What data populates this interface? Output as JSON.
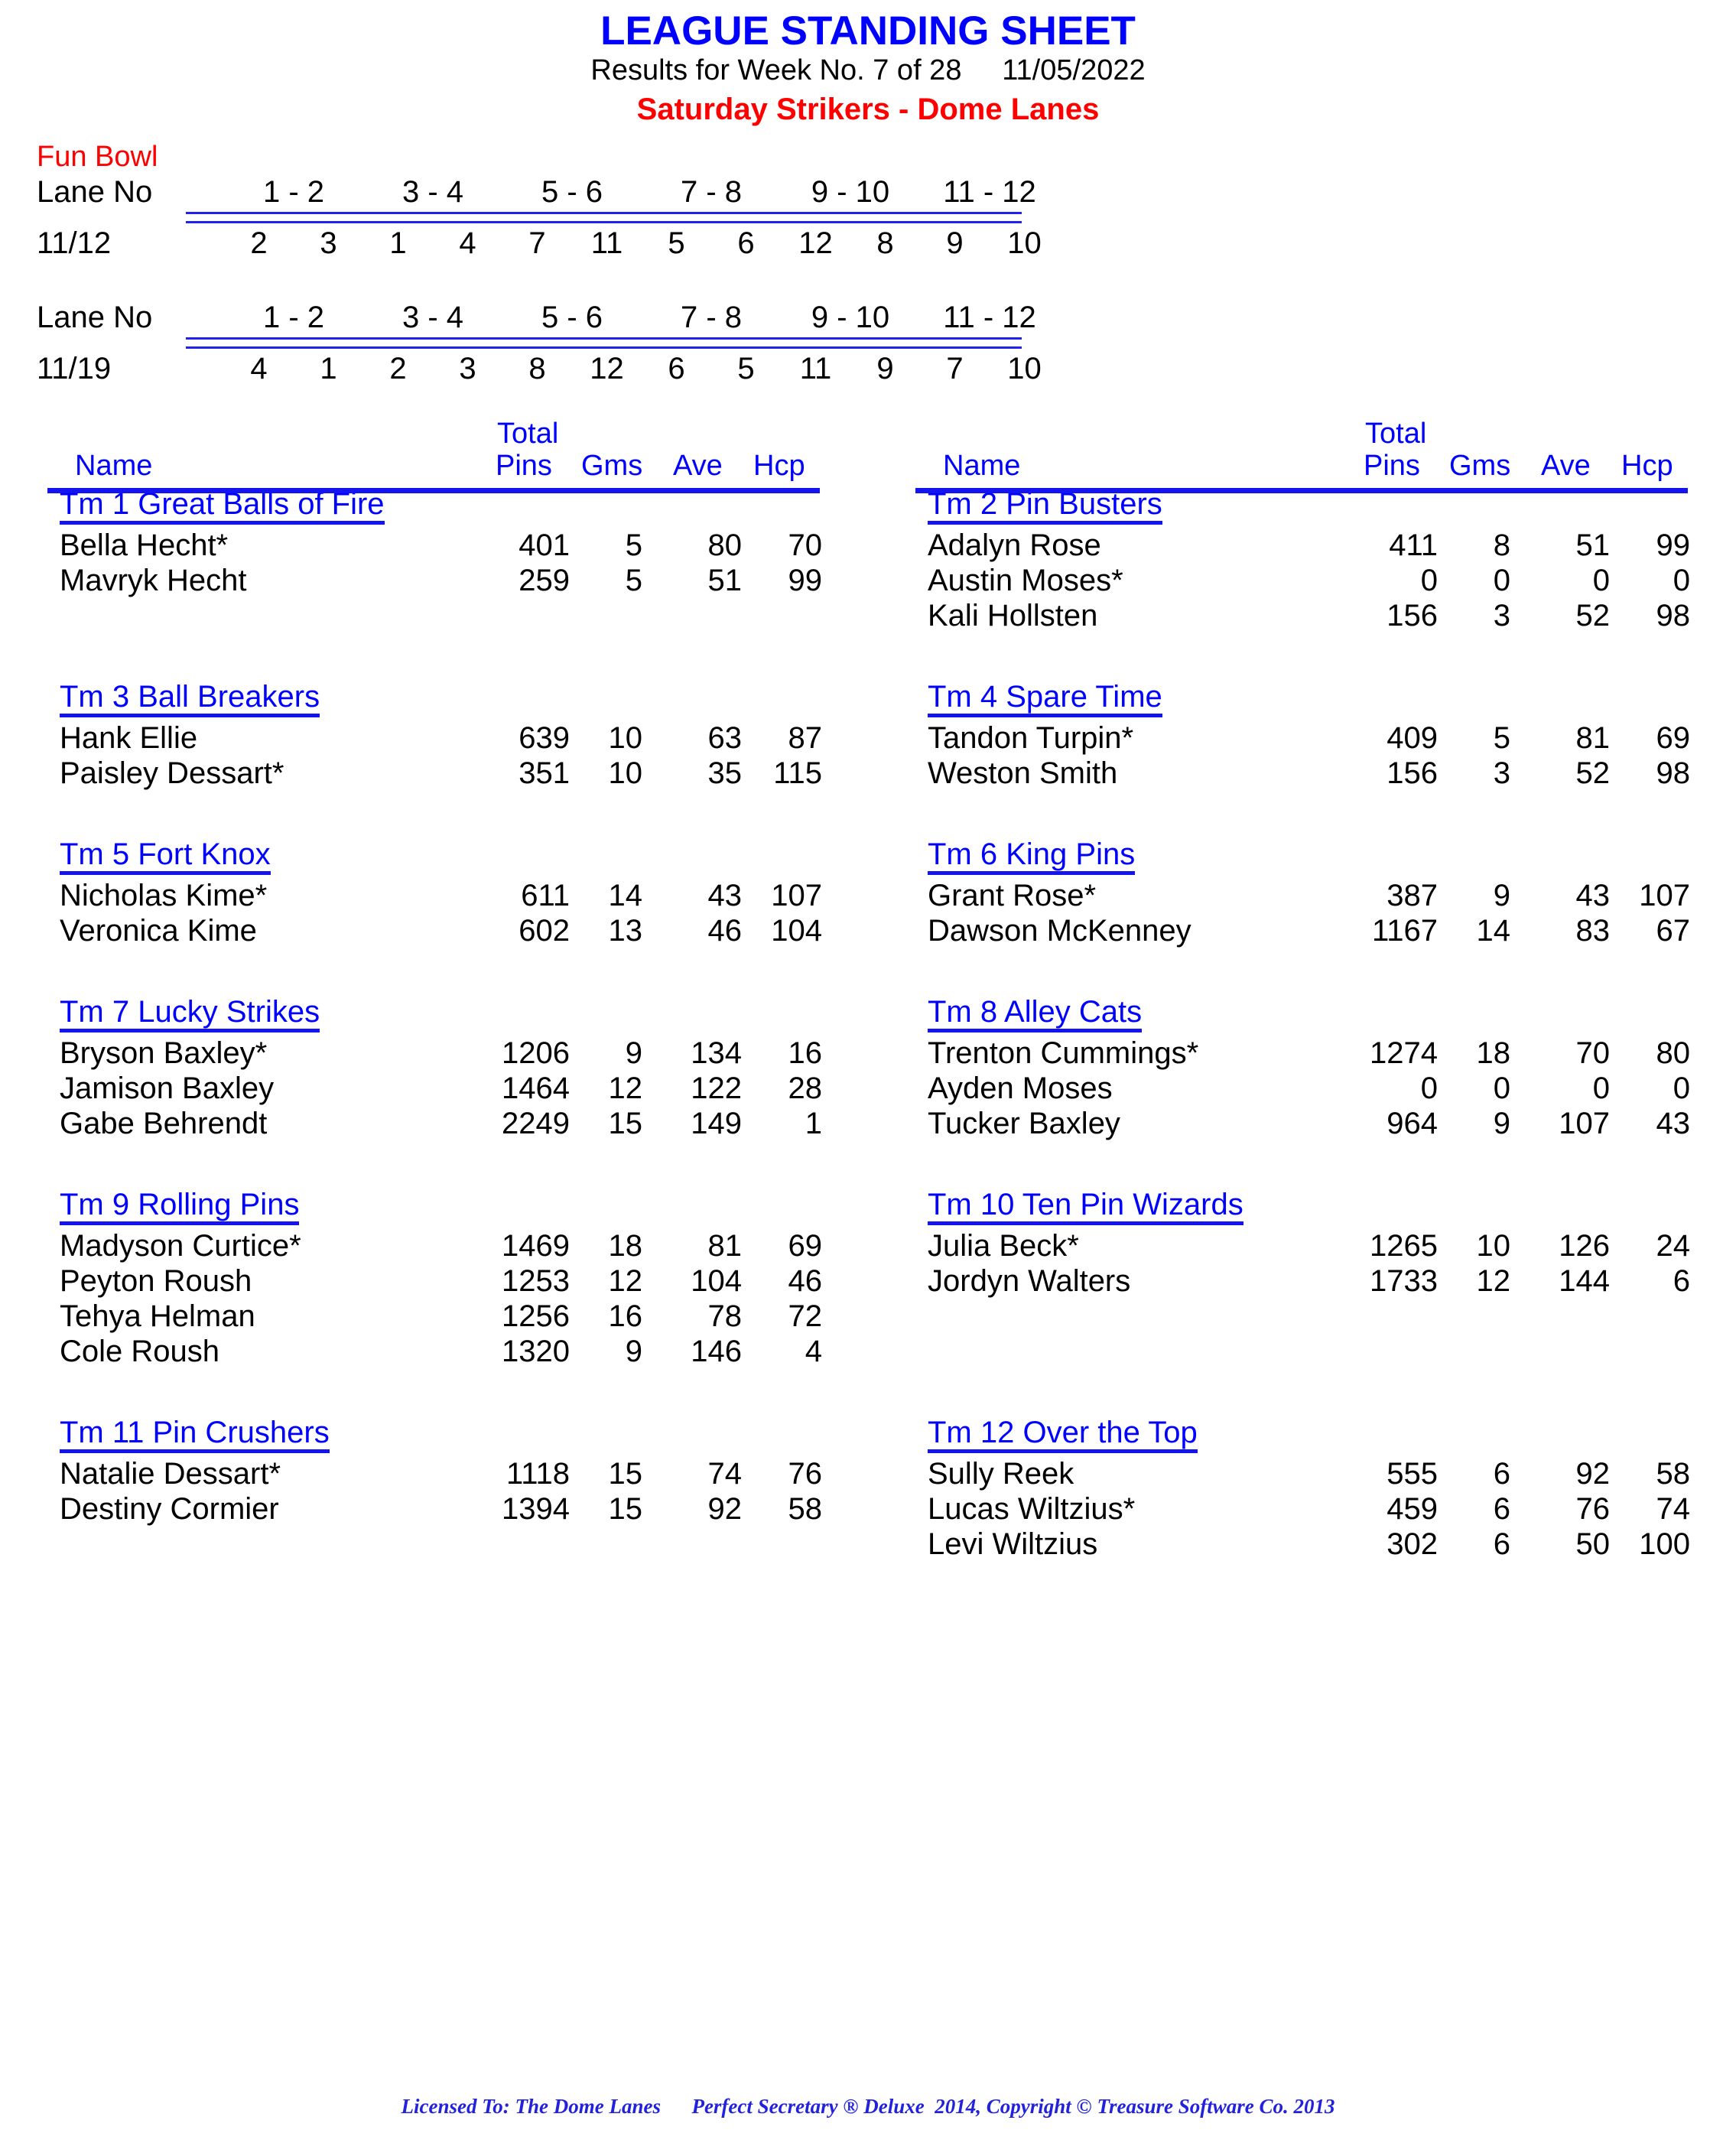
{
  "header": {
    "title": "LEAGUE STANDING SHEET",
    "results_line": "Results for Week No. 7 of 28     11/05/2022",
    "league_line": "Saturday Strikers - Dome Lanes",
    "title_color": "#0000FF",
    "league_color": "#FF0000"
  },
  "center": {
    "name": "Fun Bowl",
    "name_color": "#FF0000"
  },
  "schedule": {
    "lane_label": "Lane No",
    "lane_pairs": [
      "1 - 2",
      "3 - 4",
      "5 - 6",
      "7 - 8",
      "9 - 10",
      "11 - 12"
    ],
    "weeks": [
      {
        "date": "11/12",
        "teams": [
          "2",
          "3",
          "1",
          "4",
          "7",
          "11",
          "5",
          "6",
          "12",
          "8",
          "9",
          "10"
        ]
      },
      {
        "date": "11/19",
        "teams": [
          "4",
          "1",
          "2",
          "3",
          "8",
          "12",
          "6",
          "5",
          "11",
          "9",
          "7",
          "10"
        ]
      }
    ]
  },
  "table_headers": {
    "total": "Total",
    "name": "Name",
    "pins": "Pins",
    "gms": "Gms",
    "ave": "Ave",
    "hcp": "Hcp",
    "header_color": "#0000FF"
  },
  "left_column": [
    {
      "team": "Tm 1 Great Balls of Fire",
      "players": [
        {
          "name": "Bella Hecht*",
          "pins": "401",
          "gms": "5",
          "ave": "80",
          "hcp": "70"
        },
        {
          "name": "Mavryk Hecht",
          "pins": "259",
          "gms": "5",
          "ave": "51",
          "hcp": "99"
        }
      ]
    },
    {
      "team": "Tm 3 Ball Breakers",
      "players": [
        {
          "name": "Hank Ellie",
          "pins": "639",
          "gms": "10",
          "ave": "63",
          "hcp": "87"
        },
        {
          "name": "Paisley Dessart*",
          "pins": "351",
          "gms": "10",
          "ave": "35",
          "hcp": "115"
        }
      ]
    },
    {
      "team": "Tm 5 Fort Knox",
      "players": [
        {
          "name": "Nicholas Kime*",
          "pins": "611",
          "gms": "14",
          "ave": "43",
          "hcp": "107"
        },
        {
          "name": "Veronica Kime",
          "pins": "602",
          "gms": "13",
          "ave": "46",
          "hcp": "104"
        }
      ]
    },
    {
      "team": "Tm 7 Lucky Strikes",
      "players": [
        {
          "name": "Bryson Baxley*",
          "pins": "1206",
          "gms": "9",
          "ave": "134",
          "hcp": "16"
        },
        {
          "name": "Jamison Baxley",
          "pins": "1464",
          "gms": "12",
          "ave": "122",
          "hcp": "28"
        },
        {
          "name": "Gabe Behrendt",
          "pins": "2249",
          "gms": "15",
          "ave": "149",
          "hcp": "1"
        }
      ]
    },
    {
      "team": "Tm 9 Rolling Pins",
      "players": [
        {
          "name": "Madyson Curtice*",
          "pins": "1469",
          "gms": "18",
          "ave": "81",
          "hcp": "69"
        },
        {
          "name": "Peyton Roush",
          "pins": "1253",
          "gms": "12",
          "ave": "104",
          "hcp": "46"
        },
        {
          "name": "Tehya Helman",
          "pins": "1256",
          "gms": "16",
          "ave": "78",
          "hcp": "72"
        },
        {
          "name": "Cole Roush",
          "pins": "1320",
          "gms": "9",
          "ave": "146",
          "hcp": "4"
        }
      ]
    },
    {
      "team": "Tm 11 Pin Crushers",
      "players": [
        {
          "name": "Natalie Dessart*",
          "pins": "1118",
          "gms": "15",
          "ave": "74",
          "hcp": "76"
        },
        {
          "name": "Destiny Cormier",
          "pins": "1394",
          "gms": "15",
          "ave": "92",
          "hcp": "58"
        }
      ]
    }
  ],
  "right_column": [
    {
      "team": "Tm 2 Pin Busters",
      "players": [
        {
          "name": "Adalyn Rose",
          "pins": "411",
          "gms": "8",
          "ave": "51",
          "hcp": "99"
        },
        {
          "name": "Austin Moses*",
          "pins": "0",
          "gms": "0",
          "ave": "0",
          "hcp": "0"
        },
        {
          "name": "Kali Hollsten",
          "pins": "156",
          "gms": "3",
          "ave": "52",
          "hcp": "98"
        }
      ]
    },
    {
      "team": "Tm 4 Spare Time",
      "players": [
        {
          "name": "Tandon Turpin*",
          "pins": "409",
          "gms": "5",
          "ave": "81",
          "hcp": "69"
        },
        {
          "name": "Weston Smith",
          "pins": "156",
          "gms": "3",
          "ave": "52",
          "hcp": "98"
        }
      ]
    },
    {
      "team": "Tm 6 King Pins",
      "players": [
        {
          "name": "Grant Rose*",
          "pins": "387",
          "gms": "9",
          "ave": "43",
          "hcp": "107"
        },
        {
          "name": "Dawson McKenney",
          "pins": "1167",
          "gms": "14",
          "ave": "83",
          "hcp": "67"
        }
      ]
    },
    {
      "team": "Tm 8 Alley Cats",
      "players": [
        {
          "name": "Trenton Cummings*",
          "pins": "1274",
          "gms": "18",
          "ave": "70",
          "hcp": "80"
        },
        {
          "name": "Ayden Moses",
          "pins": "0",
          "gms": "0",
          "ave": "0",
          "hcp": "0"
        },
        {
          "name": "Tucker Baxley",
          "pins": "964",
          "gms": "9",
          "ave": "107",
          "hcp": "43"
        }
      ]
    },
    {
      "team": "Tm 10 Ten Pin Wizards",
      "players": [
        {
          "name": "Julia Beck*",
          "pins": "1265",
          "gms": "10",
          "ave": "126",
          "hcp": "24"
        },
        {
          "name": "Jordyn Walters",
          "pins": "1733",
          "gms": "12",
          "ave": "144",
          "hcp": "6"
        }
      ]
    },
    {
      "team": "Tm 12 Over the Top",
      "players": [
        {
          "name": "Sully Reek",
          "pins": "555",
          "gms": "6",
          "ave": "92",
          "hcp": "58"
        },
        {
          "name": "Lucas Wiltzius*",
          "pins": "459",
          "gms": "6",
          "ave": "76",
          "hcp": "74"
        },
        {
          "name": "Levi Wiltzius",
          "pins": "302",
          "gms": "6",
          "ave": "50",
          "hcp": "100"
        }
      ]
    }
  ],
  "footer": {
    "text": "Licensed To: The Dome Lanes      Perfect Secretary ® Deluxe  2014, Copyright © Treasure Software Co. 2013",
    "color": "#2222DD"
  }
}
